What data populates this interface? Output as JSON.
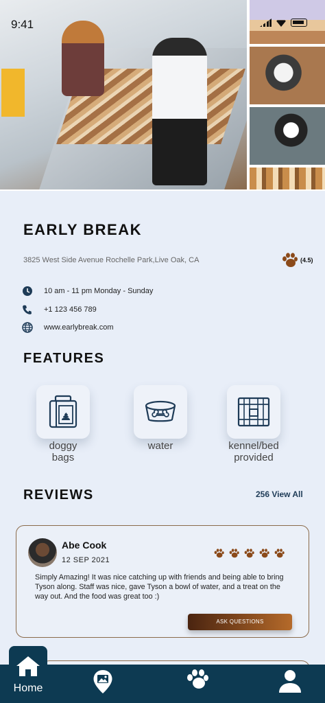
{
  "status_bar": {
    "time": "9:41"
  },
  "venue": {
    "name": "EARLY BREAK",
    "address": "3825 West Side Avenue Rochelle Park,Live Oak, CA",
    "rating": "(4.5)",
    "hours": "10 am - 11 pm Monday - Sunday",
    "phone": "+1 123 456 789",
    "website": "www.earlybreak.com"
  },
  "features": {
    "title": "FEATURES",
    "items": [
      {
        "label_line1": "doggy",
        "label_line2": "bags",
        "icon": "doggy-bag-icon"
      },
      {
        "label_line1": "water",
        "label_line2": "",
        "icon": "water-bowl-icon"
      },
      {
        "label_line1": "kennel/bed",
        "label_line2": "provided",
        "icon": "kennel-icon"
      }
    ]
  },
  "reviews": {
    "title": "REVIEWS",
    "view_all": "256 View All",
    "items": [
      {
        "name": "Abe Cook",
        "date": "12 SEP 2021",
        "rating": 5,
        "text": "Simply Amazing! It was nice catching up with friends and being able to bring Tyson along. Staff was nice, gave Tyson a bowl of water, and a treat on the way out. And the food was great too :)",
        "button": "ASK QUESTIONS"
      }
    ]
  },
  "nav": {
    "home_label": "Home",
    "items": [
      "home-icon",
      "map-pin-icon",
      "paw-icon",
      "profile-icon"
    ]
  },
  "colors": {
    "accent": "#0d3a52",
    "paw": "#8b4a1a",
    "link": "#1e3b57"
  }
}
